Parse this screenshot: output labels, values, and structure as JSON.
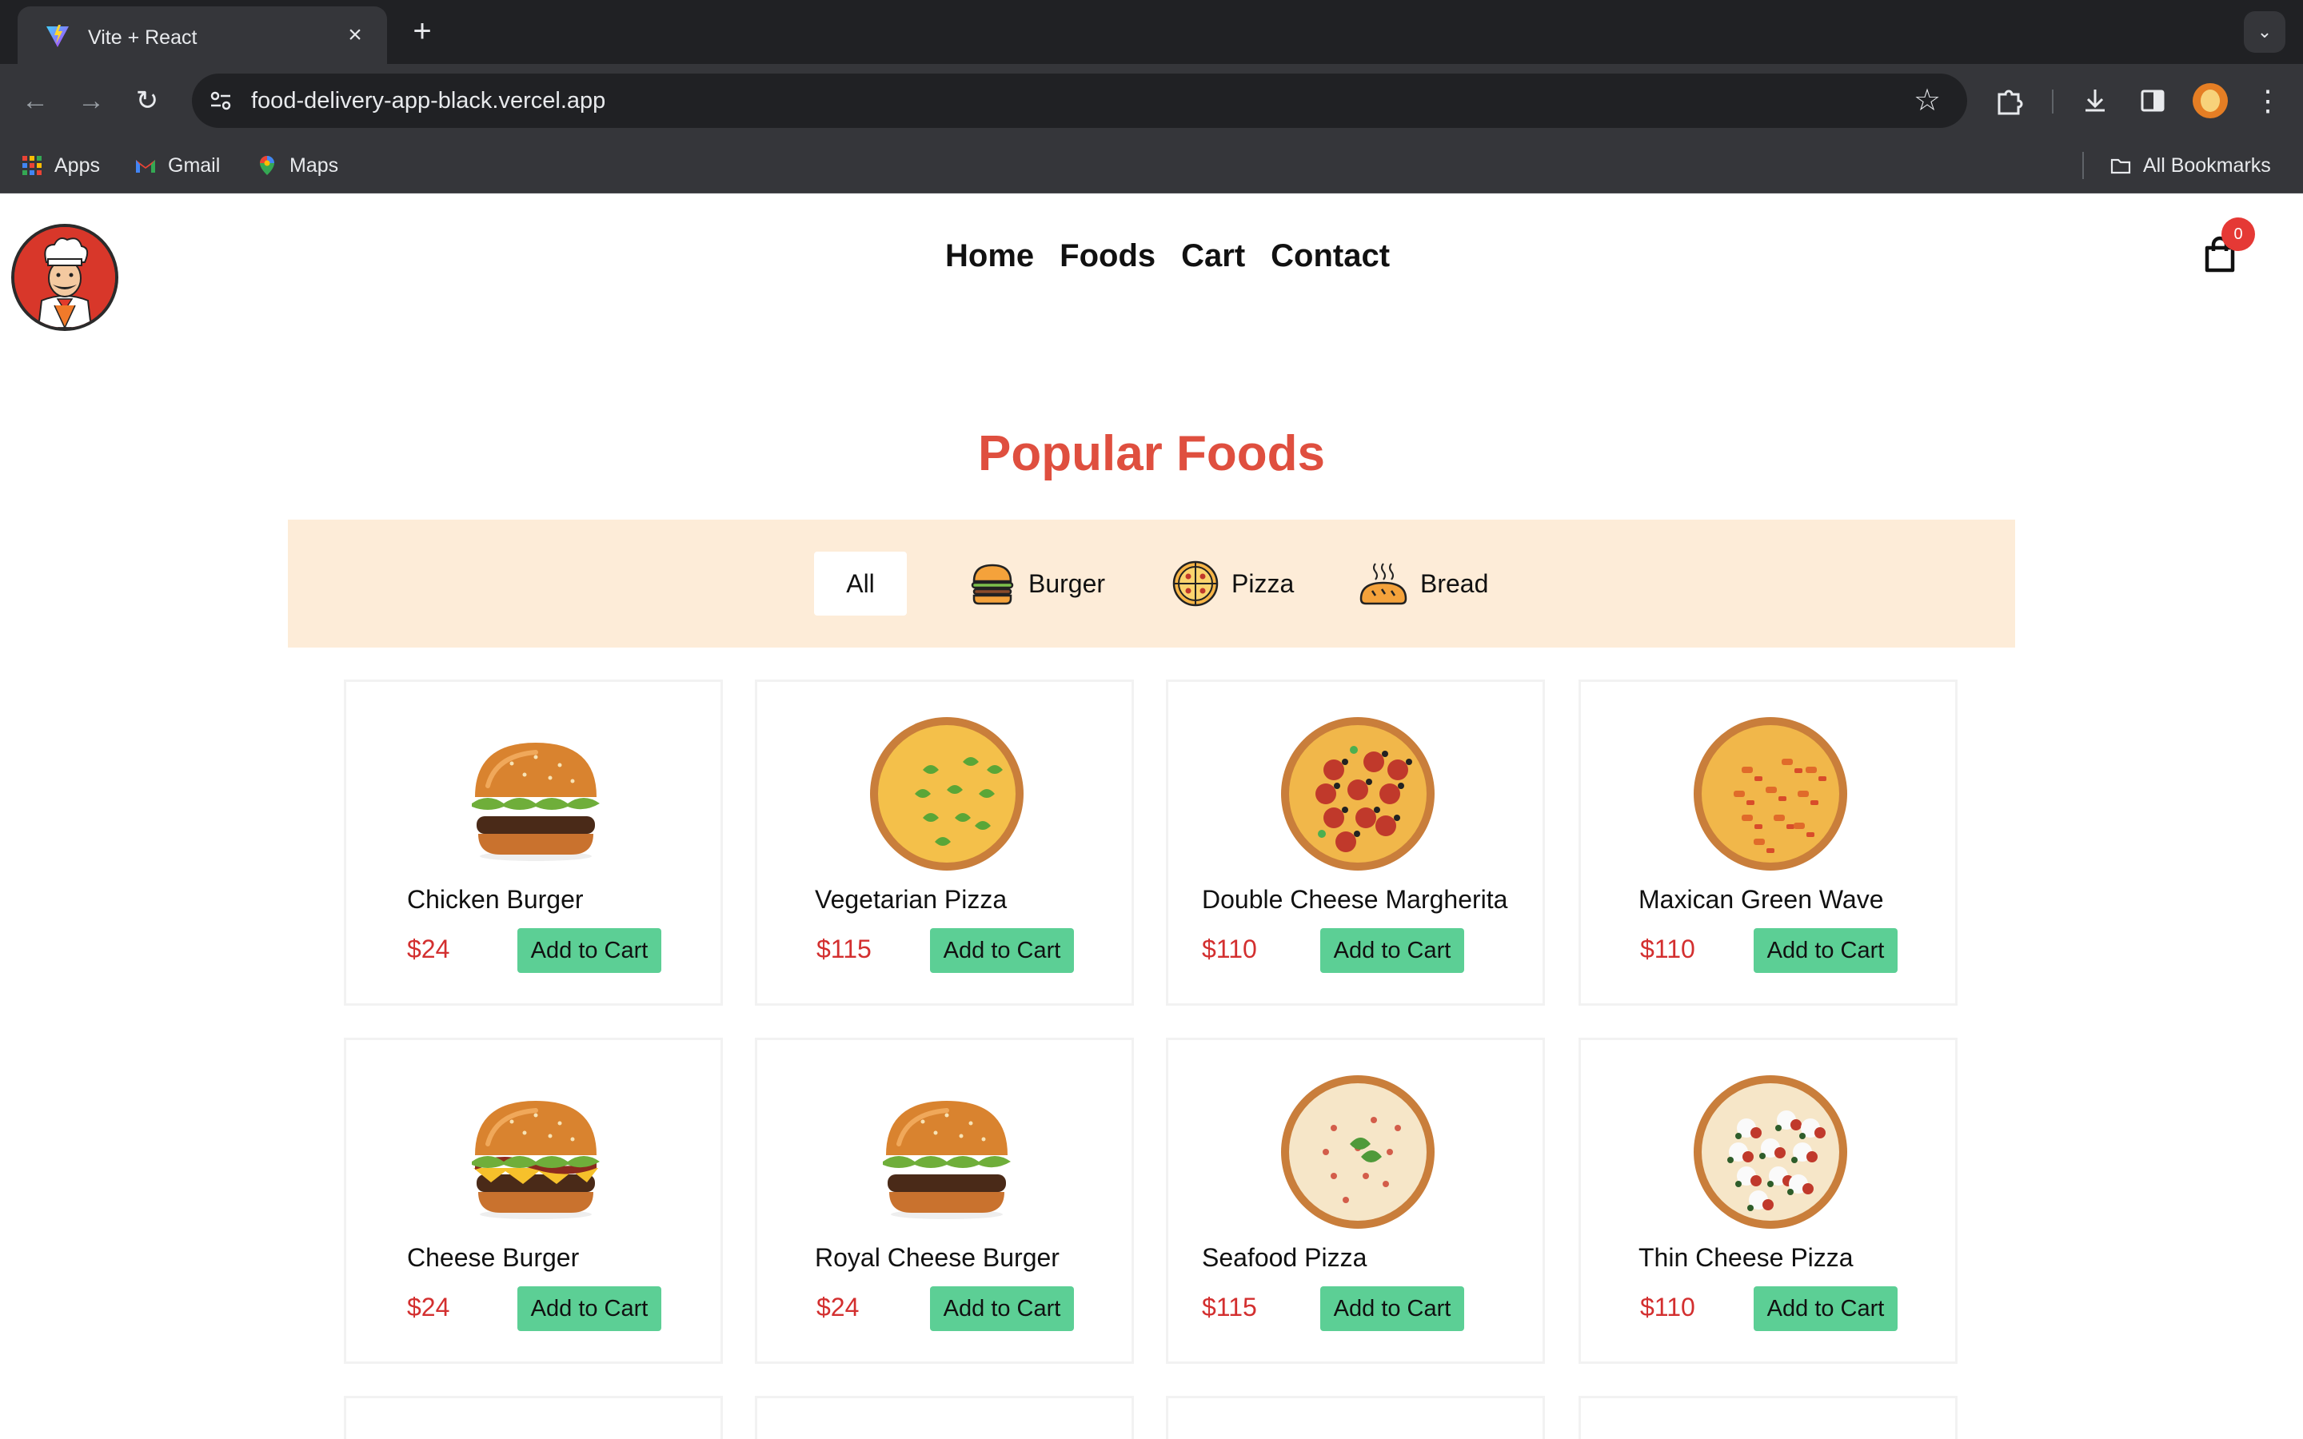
{
  "browser": {
    "tab_title": "Vite + React",
    "url": "food-delivery-app-black.vercel.app",
    "bookmarks": [
      "Apps",
      "Gmail",
      "Maps"
    ],
    "all_bookmarks": "All Bookmarks"
  },
  "header": {
    "nav": [
      "Home",
      "Foods",
      "Cart",
      "Contact"
    ],
    "cart_count": "0"
  },
  "section_title": "Popular Foods",
  "filters": {
    "all": "All",
    "burger": "Burger",
    "pizza": "Pizza",
    "bread": "Bread"
  },
  "add_label": "Add to Cart",
  "products": [
    {
      "name": "Chicken Burger",
      "price": "$24",
      "kind": "burger-chicken"
    },
    {
      "name": "Vegetarian Pizza",
      "price": "$115",
      "kind": "pizza-veg"
    },
    {
      "name": "Double Cheese Margherita",
      "price": "$110",
      "kind": "pizza-pepperoni"
    },
    {
      "name": "Maxican Green Wave",
      "price": "$110",
      "kind": "pizza-mexican"
    },
    {
      "name": "Cheese Burger",
      "price": "$24",
      "kind": "burger-cheese"
    },
    {
      "name": "Royal Cheese Burger",
      "price": "$24",
      "kind": "burger-royal"
    },
    {
      "name": "Seafood Pizza",
      "price": "$115",
      "kind": "pizza-seafood"
    },
    {
      "name": "Thin Cheese Pizza",
      "price": "$110",
      "kind": "pizza-thin"
    }
  ],
  "colors": {
    "accent_title": "#df4f3f",
    "price": "#d32f2f",
    "button": "#5ccf95",
    "filter_bg": "#fdecd8",
    "badge": "#e53935"
  }
}
